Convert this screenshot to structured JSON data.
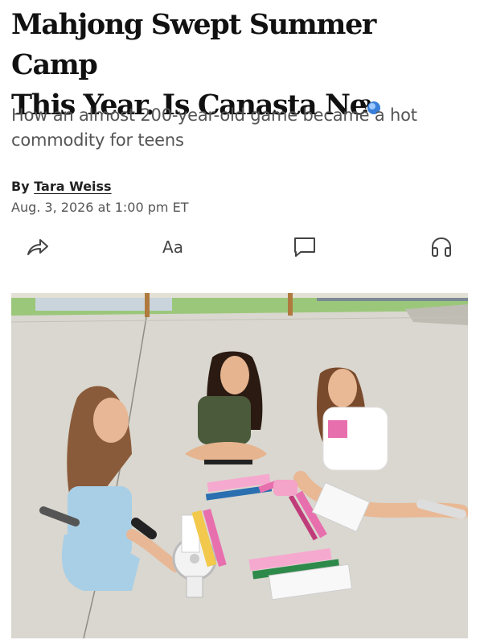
{
  "article": {
    "headline_part1": "Mahjong Swept Summer Camp",
    "headline_part2": "This Year. Is Canasta Ne",
    "dek": "How an almost 200-year-old game became a hot commodity for teens",
    "byline_prefix": "By ",
    "author": "Tara Weiss",
    "date": "Aug. 3, 2026 at 1:00 pm ET"
  },
  "toolbar": {
    "share_icon": "share-arrow-icon",
    "text_size_label": "Aa",
    "comment_icon": "comment-bubble-icon",
    "listen_icon": "headphones-icon"
  },
  "photo": {
    "description_icon": "article-photo",
    "colors": {
      "floor": "#d9d7cf",
      "grass": "#8ec466",
      "tile_pink": "#e86fae",
      "rack_green": "#2e8a4a",
      "shorts_blue": "#a9cfe6"
    }
  }
}
